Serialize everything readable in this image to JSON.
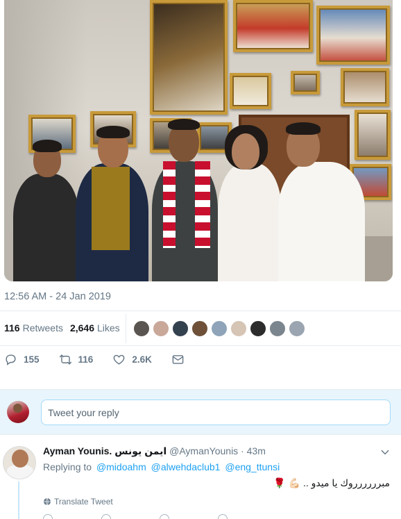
{
  "tweet": {
    "timestamp": "12:56 AM - 24 Jan 2019",
    "retweets_count": "116",
    "retweets_label": "Retweets",
    "likes_count": "2,646",
    "likes_label": "Likes"
  },
  "actions": {
    "reply_count": "155",
    "retweet_count": "116",
    "like_count": "2.6K"
  },
  "composer": {
    "placeholder": "Tweet your reply"
  },
  "reply": {
    "name": "Ayman Younis. ايمن يونس",
    "handle": "@AymanYounis",
    "separator": "·",
    "time": "43m",
    "replying_to_label": "Replying to",
    "mentions": [
      "@midoahm",
      "@alwehdaclub1",
      "@eng_ttunsi"
    ],
    "text": "مبرررررروك يا ميدو .. 💪🏻 🌹",
    "translate_label": "Translate Tweet"
  },
  "colors": {
    "link": "#1da1f2",
    "muted": "#657786",
    "composer_bg": "#e8f5fd"
  },
  "likers": [
    "#5a5550",
    "#c9a89a",
    "#34414f",
    "#6e5138",
    "#8fa4b8",
    "#d6c4b4",
    "#2c2c2c",
    "#7b858d",
    "#9aa5b1"
  ]
}
